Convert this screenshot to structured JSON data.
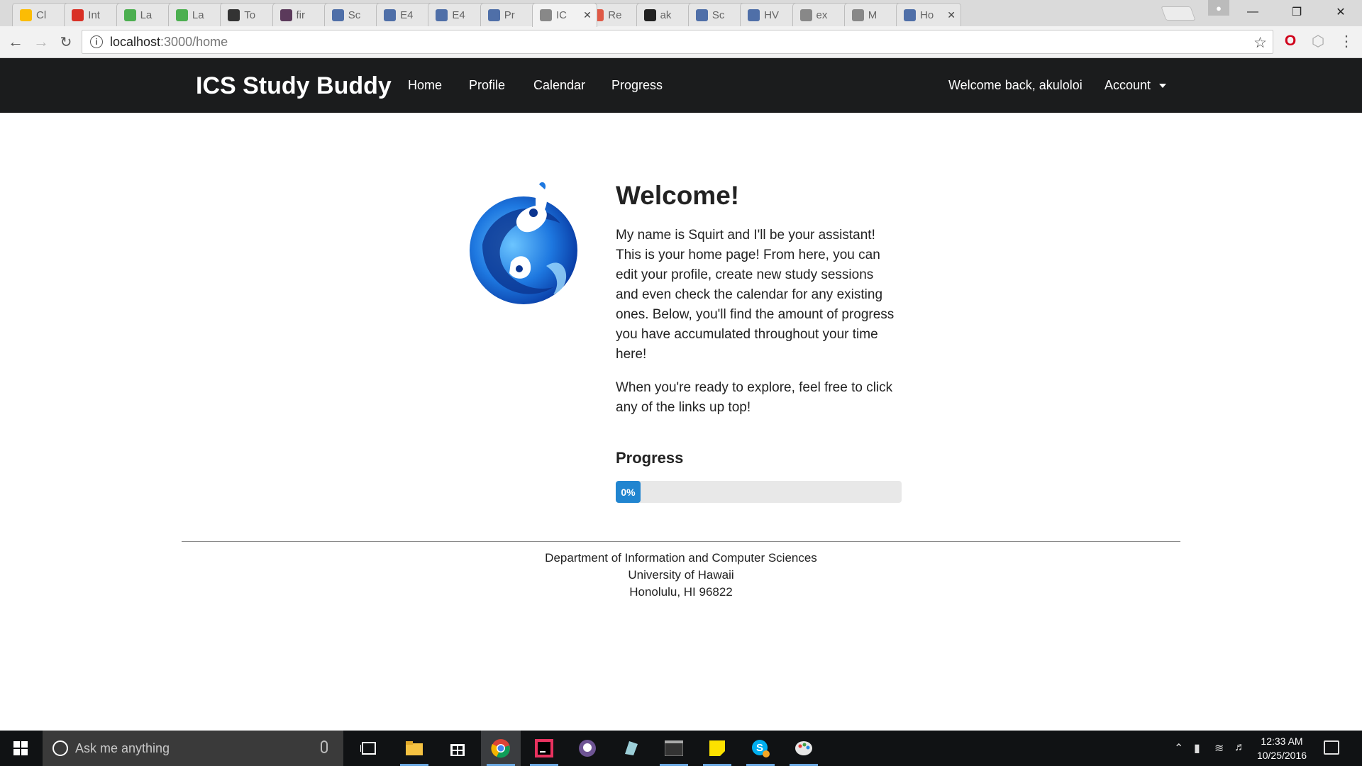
{
  "browser": {
    "tabs": [
      {
        "label": "Cl",
        "color": "#fbbc05"
      },
      {
        "label": "Int",
        "color": "#d93025"
      },
      {
        "label": "La",
        "color": "#4caf50"
      },
      {
        "label": "La",
        "color": "#4caf50"
      },
      {
        "label": "To",
        "color": "#333333"
      },
      {
        "label": "fir",
        "color": "#5b3a5b"
      },
      {
        "label": "Sc",
        "color": "#4f6fa8"
      },
      {
        "label": "E4",
        "color": "#4f6fa8"
      },
      {
        "label": "E4",
        "color": "#4f6fa8"
      },
      {
        "label": "Pr",
        "color": "#4f6fa8"
      },
      {
        "label": "IC",
        "color": "#888888"
      },
      {
        "label": "Re",
        "color": "#e05a47"
      },
      {
        "label": "ak",
        "color": "#222222"
      },
      {
        "label": "Sc",
        "color": "#4f6fa8"
      },
      {
        "label": "HV",
        "color": "#4f6fa8"
      },
      {
        "label": "ex",
        "color": "#888888"
      },
      {
        "label": "M",
        "color": "#888888"
      },
      {
        "label": "Ho",
        "color": "#4f6fa8"
      }
    ],
    "active_tab_index": 10,
    "url_host": "localhost",
    "url_path": ":3000/home"
  },
  "navbar": {
    "brand": "ICS Study Buddy",
    "links": [
      "Home",
      "Profile",
      "Calendar",
      "Progress"
    ],
    "welcome": "Welcome back, akuloloi",
    "account": "Account"
  },
  "main": {
    "title": "Welcome!",
    "intro": "My name is Squirt and I'll be your assistant! This is your home page! From here, you can edit your profile, create new study sessions and even check the calendar for any existing ones. Below, you'll find the amount of progress you have accumulated throughout your time here!",
    "intro2": "When you're ready to explore, feel free to click any of the links up top!",
    "progress_title": "Progress",
    "progress_value": 0,
    "progress_label": "0%"
  },
  "footer": {
    "line1": "Department of Information and Computer Sciences",
    "line2": "University of Hawaii",
    "line3": "Honolulu, HI 96822"
  },
  "taskbar": {
    "search_placeholder": "Ask me anything",
    "time": "12:33 AM",
    "date": "10/25/2016"
  },
  "colors": {
    "navbar_bg": "#1b1c1d",
    "progress_fill": "#2185d0",
    "progress_track": "#e8e8e8"
  }
}
